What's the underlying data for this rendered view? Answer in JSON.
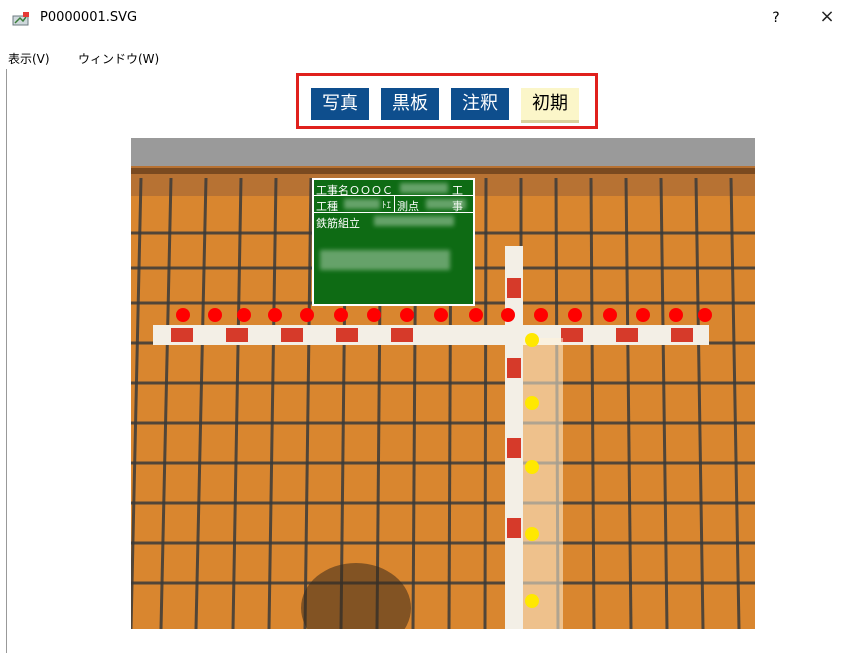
{
  "window": {
    "title": "P0000001.SVG",
    "help_label": "?",
    "close_label": "×"
  },
  "menu": {
    "items": [
      "表示(V)",
      "ウィンドウ(W)"
    ]
  },
  "toolbar": {
    "buttons": [
      "写真",
      "黒板",
      "注釈",
      "初期"
    ]
  },
  "board": {
    "row1_label": "工事名ＯＯＯＣ",
    "row1_right": "工事",
    "row2_label": "工種",
    "row2_mid": "ﾄｴ",
    "row2_right": "測点",
    "row3_label": "鉄筋組立"
  },
  "colors": {
    "accent_border": "#e0201d",
    "button_blue": "#0e4e8d",
    "button_active": "#fbf6c9",
    "board_green": "#0e6b14",
    "marker_red": "#ff0000",
    "marker_yellow": "#ffe800"
  }
}
